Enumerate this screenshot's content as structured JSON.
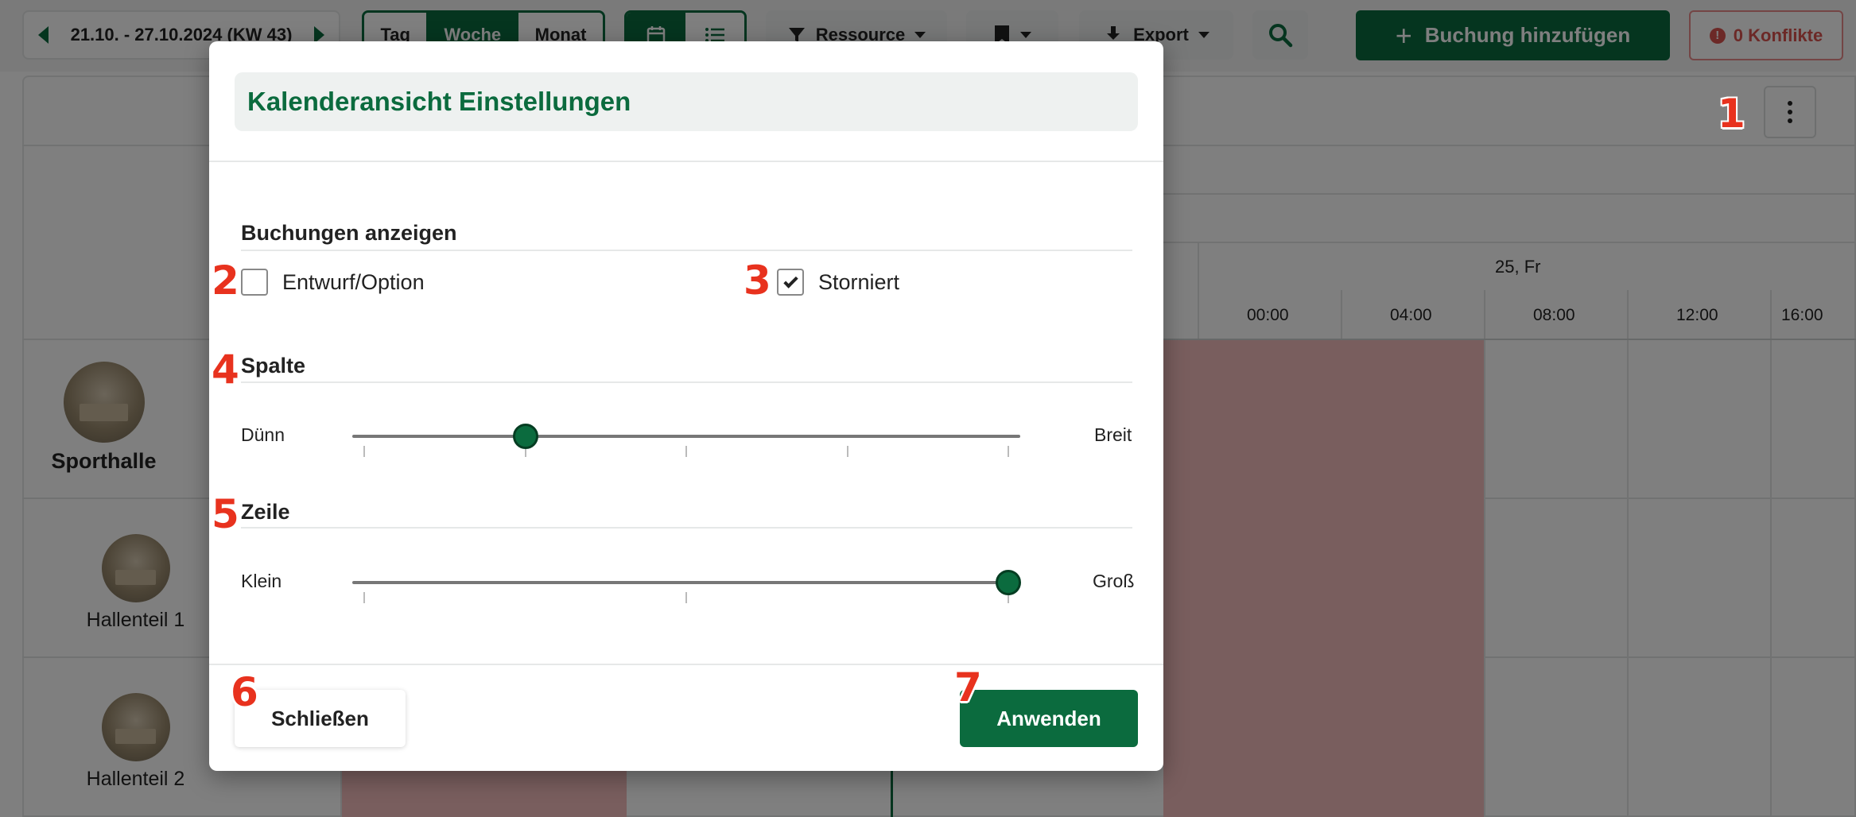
{
  "toolbar": {
    "week_range": "21.10. - 27.10.2024 (KW 43)",
    "views": [
      "Tag",
      "Woche",
      "Monat"
    ],
    "active_view": "Woche",
    "ressource_label": "Ressource",
    "export_label": "Export",
    "add_booking_label": "Buchung hinzufügen",
    "conflicts_label": "0 Konflikte",
    "conflicts_icon": "!"
  },
  "calendar": {
    "day_label": "25, Fr",
    "hours": [
      "00:00",
      "04:00",
      "08:00",
      "12:00",
      "16:00"
    ],
    "resources": [
      {
        "name": "Sporthalle"
      },
      {
        "name": "Hallenteil 1"
      },
      {
        "name": "Hallenteil 2"
      }
    ]
  },
  "modal": {
    "title": "Kalenderansicht Einstellungen",
    "show_bookings": {
      "title": "Buchungen anzeigen",
      "draft": {
        "label": "Entwurf/Option",
        "checked": false
      },
      "cancelled": {
        "label": "Storniert",
        "checked": true
      }
    },
    "column": {
      "title": "Spalte",
      "min_label": "Dünn",
      "max_label": "Breit",
      "value_fraction": 0.25,
      "steps": 5
    },
    "row": {
      "title": "Zeile",
      "min_label": "Klein",
      "max_label": "Groß",
      "value_fraction": 1.0,
      "steps": 3
    },
    "close_label": "Schließen",
    "apply_label": "Anwenden"
  },
  "steps": [
    "1",
    "2",
    "3",
    "4",
    "5",
    "6",
    "7"
  ],
  "colors": {
    "brand_green": "#0b6b3e",
    "step_red": "#e8321e",
    "conflict_red": "#d9534f",
    "booked": "#f3bcbc"
  }
}
